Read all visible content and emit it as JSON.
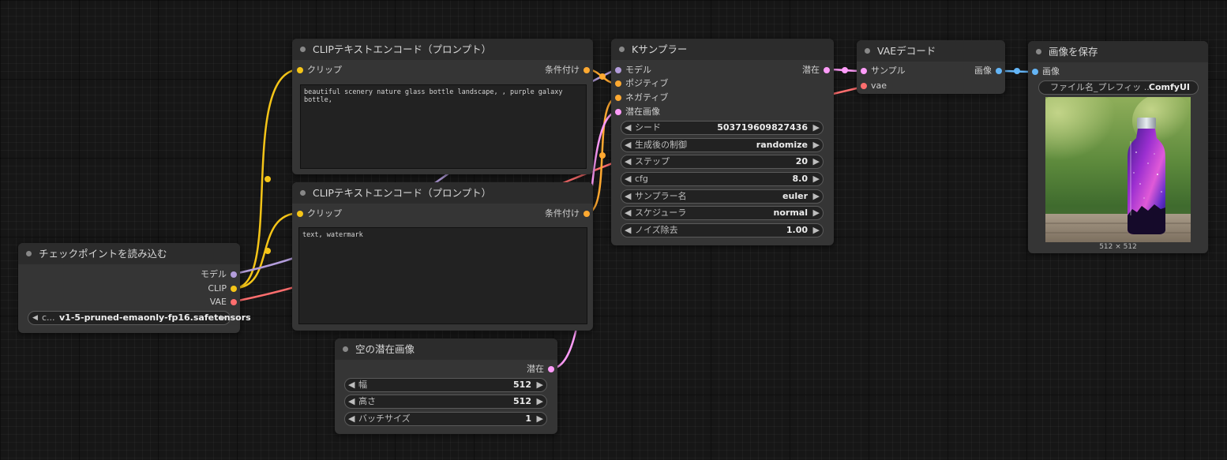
{
  "colors": {
    "clip": "#f5c518",
    "model": "#b39ddb",
    "vae": "#ff6e6e",
    "conditioning": "#ffa931",
    "latent": "#ff9cf9",
    "image": "#64b5f6"
  },
  "checkpoint": {
    "title": "チェックポイントを読み込む",
    "outputs": {
      "model": "モデル",
      "clip": "CLIP",
      "vae": "VAE"
    },
    "ckpt_label": "c...",
    "ckpt_value": "v1-5-pruned-emaonly-fp16.safetensors"
  },
  "clip_pos": {
    "title": "CLIPテキストエンコード（プロンプト）",
    "input_clip": "クリップ",
    "output": "条件付け",
    "text": "beautiful scenery nature glass bottle landscape, , purple galaxy bottle,"
  },
  "clip_neg": {
    "title": "CLIPテキストエンコード（プロンプト）",
    "input_clip": "クリップ",
    "output": "条件付け",
    "text": "text, watermark"
  },
  "latent": {
    "title": "空の潜在画像",
    "output": "潜在",
    "widgets": [
      {
        "name": "幅",
        "value": "512"
      },
      {
        "name": "高さ",
        "value": "512"
      },
      {
        "name": "バッチサイズ",
        "value": "1"
      }
    ]
  },
  "ksampler": {
    "title": "Kサンプラー",
    "inputs": {
      "model": "モデル",
      "positive": "ポジティブ",
      "negative": "ネガティブ",
      "latent": "潜在画像"
    },
    "output": "潜在",
    "widgets": [
      {
        "name": "シード",
        "value": "503719609827436"
      },
      {
        "name": "生成後の制御",
        "value": "randomize"
      },
      {
        "name": "ステップ",
        "value": "20"
      },
      {
        "name": "cfg",
        "value": "8.0"
      },
      {
        "name": "サンプラー名",
        "value": "euler"
      },
      {
        "name": "スケジューラ",
        "value": "normal"
      },
      {
        "name": "ノイズ除去",
        "value": "1.00"
      }
    ]
  },
  "vae_decode": {
    "title": "VAEデコード",
    "inputs": {
      "samples": "サンプル",
      "vae": "vae"
    },
    "output": "画像"
  },
  "save_image": {
    "title": "画像を保存",
    "input": "画像",
    "prefix_label": "ファイル名_プレフィッ ...",
    "prefix_value": "ComfyUI",
    "image_size": "512 × 512"
  }
}
